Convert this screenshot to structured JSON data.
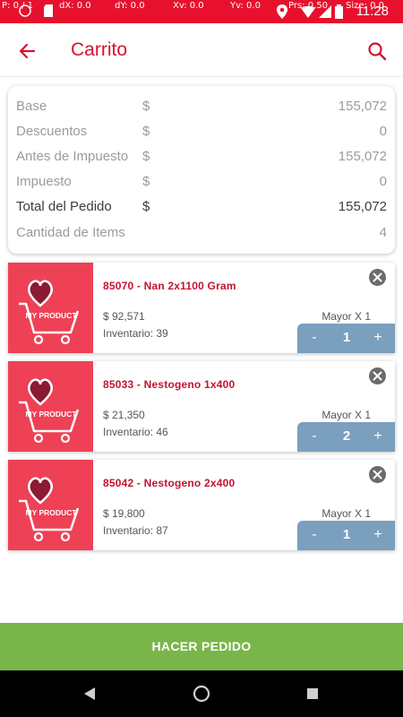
{
  "status_bar": {
    "debug": [
      "P: 0 / 1",
      "dX: 0.0",
      "dY: 0.0",
      "Xv: 0.0",
      "Yv: 0.0",
      "Prs: 0.50",
      "Size: 0.0"
    ],
    "time": "11:28",
    "color": "#e8112d"
  },
  "header": {
    "title": "Carrito",
    "back_icon": "arrow-left-icon",
    "search_icon": "search-icon",
    "accent": "#d8112d"
  },
  "summary": {
    "currency_symbol": "$",
    "rows": [
      {
        "label": "Base",
        "currency": "$",
        "value": "155,072"
      },
      {
        "label": "Descuentos",
        "currency": "$",
        "value": "0"
      },
      {
        "label": "Antes de Impuesto",
        "currency": "$",
        "value": "155,072"
      },
      {
        "label": "Impuesto",
        "currency": "$",
        "value": "0"
      },
      {
        "label": "Total del Pedido",
        "currency": "$",
        "value": "155,072"
      },
      {
        "label": "Cantidad de Items",
        "currency": "",
        "value": "4"
      }
    ]
  },
  "cart": {
    "items": [
      {
        "name": "85070 - Nan 2x1100 Gram",
        "price": "$ 92,571",
        "stock": "Inventario: 39",
        "tier": "Mayor X 1",
        "quantity": "1",
        "minus": "-",
        "plus": "+"
      },
      {
        "name": "85033 - Nestogeno 1x400",
        "price": "$ 21,350",
        "stock": "Inventario: 46",
        "tier": "Mayor X 1",
        "quantity": "2",
        "minus": "-",
        "plus": "+"
      },
      {
        "name": "85042 - Nestogeno 2x400",
        "price": "$ 19,800",
        "stock": "Inventario: 87",
        "tier": "Mayor X 1",
        "quantity": "1",
        "minus": "-",
        "plus": "+"
      }
    ],
    "placeholder_logo_text": "MY PRODUCT",
    "thumb_color": "#ee4156",
    "stepper_color": "#7b9fbe"
  },
  "footer": {
    "order_label": "HACER PEDIDO",
    "order_color": "#7ab54a"
  },
  "nav_bar": {
    "icons": [
      "back-triangle-icon",
      "home-circle-icon",
      "recents-square-icon"
    ]
  }
}
